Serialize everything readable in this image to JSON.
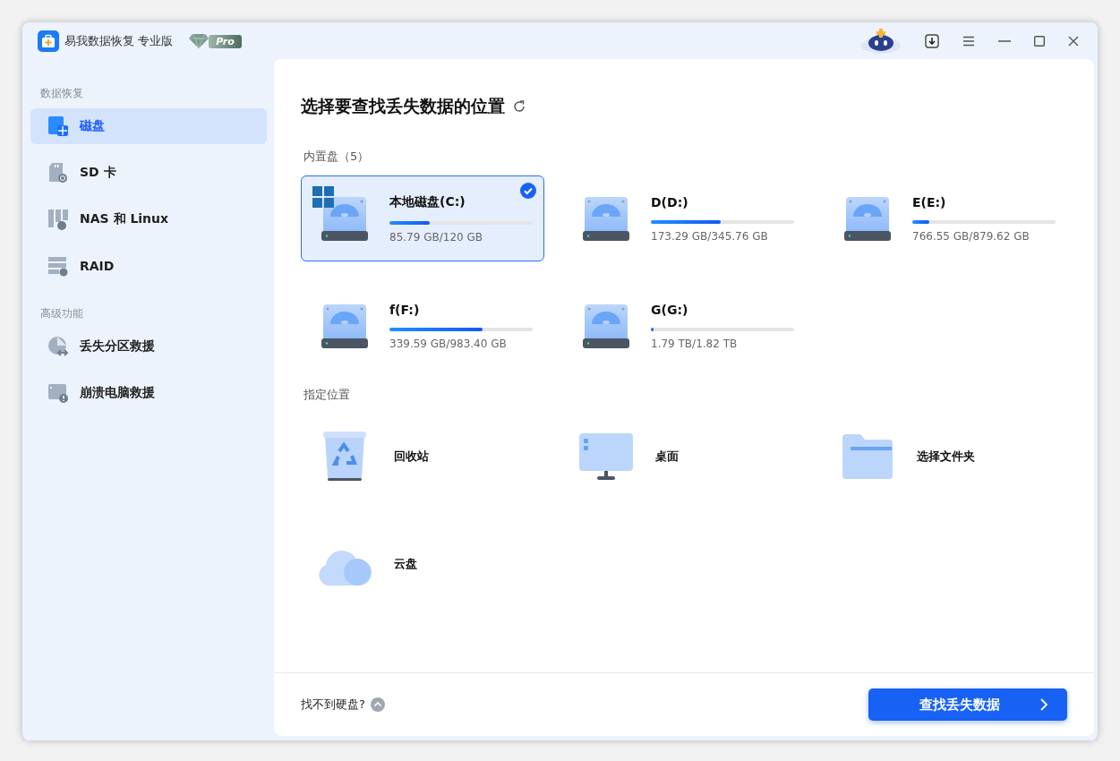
{
  "window": {
    "title": "易我数据恢复 专业版",
    "badge": "Pro"
  },
  "sidebar": {
    "sections": [
      {
        "label": "数据恢复",
        "items": [
          {
            "label": "磁盘",
            "selected": true
          },
          {
            "label": "SD 卡",
            "selected": false
          },
          {
            "label": "NAS 和 Linux",
            "selected": false
          },
          {
            "label": "RAID",
            "selected": false
          }
        ]
      },
      {
        "label": "高级功能",
        "items": [
          {
            "label": "丢失分区救援",
            "selected": false
          },
          {
            "label": "崩溃电脑救援",
            "selected": false
          }
        ]
      }
    ]
  },
  "main": {
    "heading": "选择要查找丢失数据的位置",
    "drives_label": "内置盘（5）",
    "drives": [
      {
        "name": "本地磁盘(C:)",
        "size": "85.79 GB/120 GB",
        "level": 0.28,
        "selected": true,
        "system": true
      },
      {
        "name": "D(D:)",
        "size": "173.29 GB/345.76 GB",
        "level": 0.49,
        "selected": false,
        "system": false
      },
      {
        "name": "E(E:)",
        "size": "766.55 GB/879.62 GB",
        "level": 0.12,
        "selected": false,
        "system": false
      },
      {
        "name": "f(F:)",
        "size": "339.59 GB/983.40 GB",
        "level": 0.65,
        "selected": false,
        "system": false
      },
      {
        "name": "G(G:)",
        "size": "1.79 TB/1.82 TB",
        "level": 0.02,
        "selected": false,
        "system": false
      }
    ],
    "locations_label": "指定位置",
    "locations": [
      {
        "kind": "recycle",
        "label": "回收站"
      },
      {
        "kind": "desktop",
        "label": "桌面"
      },
      {
        "kind": "folder",
        "label": "选择文件夹"
      },
      {
        "kind": "cloud",
        "label": "云盘"
      }
    ]
  },
  "footer": {
    "help": "找不到硬盘?",
    "button": "查找丢失数据"
  }
}
